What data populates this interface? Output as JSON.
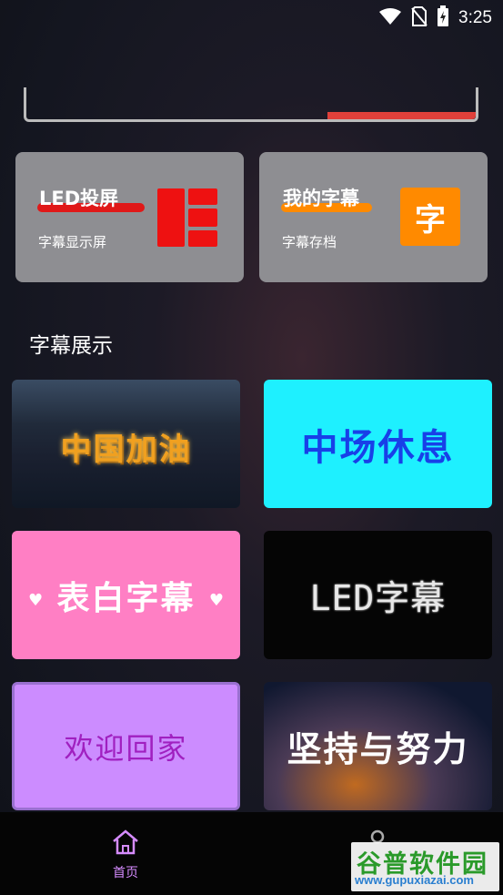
{
  "status_bar": {
    "time": "3:25",
    "icons": [
      "wifi-icon",
      "no-sim-icon",
      "battery-charging-icon"
    ]
  },
  "progress": {
    "value_fraction": 0.33,
    "fill_color": "#e0403a"
  },
  "feature_cards": [
    {
      "title": "LED投屏",
      "subtitle": "字幕显示屏",
      "icon": "led-grid-icon",
      "accent": "#ee1111"
    },
    {
      "title": "我的字幕",
      "subtitle": "字幕存档",
      "icon": "zi-icon",
      "icon_text": "字",
      "accent": "#ff8a00"
    }
  ],
  "section": {
    "title": "字幕展示"
  },
  "tiles": [
    {
      "text": "中国加油"
    },
    {
      "text": "中场休息"
    },
    {
      "text": "表白字幕"
    },
    {
      "text": "LED字幕"
    },
    {
      "text": "欢迎回家"
    },
    {
      "text": "坚持与努力"
    }
  ],
  "bottom_nav": {
    "home_label": "首页",
    "active_color": "#d68cff"
  },
  "watermark": {
    "line1": "谷普软件园",
    "line2": "www.gupuxiazai.com"
  }
}
